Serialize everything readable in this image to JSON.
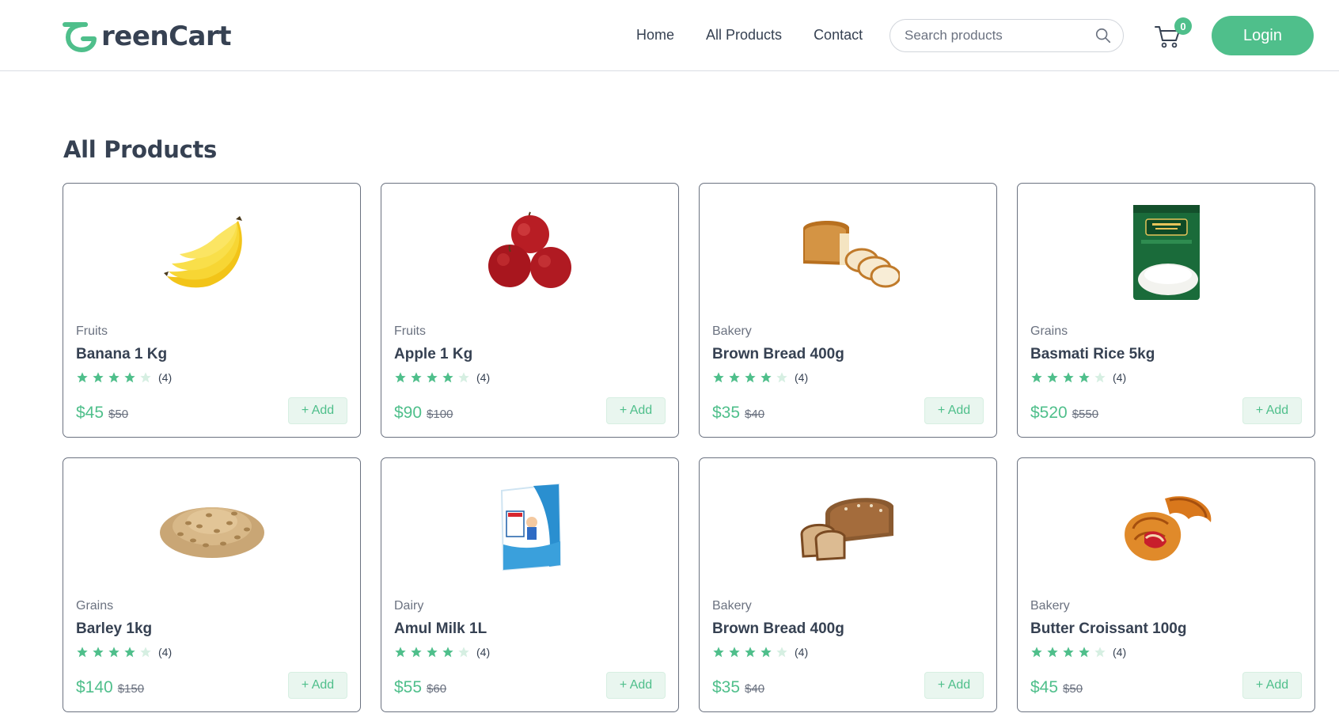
{
  "header": {
    "logo_text": "reenCart",
    "logo_initial": "G",
    "nav": [
      {
        "label": "Home"
      },
      {
        "label": "All Products"
      },
      {
        "label": "Contact"
      }
    ],
    "search_placeholder": "Search products",
    "cart_count": "0",
    "login_label": "Login"
  },
  "main": {
    "title": "All Products",
    "products": [
      {
        "category": "Fruits",
        "name": "Banana 1 Kg",
        "rating": 4,
        "rating_label": "(4)",
        "price": "$45",
        "old_price": "$50",
        "add_label": "+ Add",
        "image": "banana-image"
      },
      {
        "category": "Fruits",
        "name": "Apple 1 Kg",
        "rating": 4,
        "rating_label": "(4)",
        "price": "$90",
        "old_price": "$100",
        "add_label": "+ Add",
        "image": "apple-image"
      },
      {
        "category": "Bakery",
        "name": "Brown Bread 400g",
        "rating": 4,
        "rating_label": "(4)",
        "price": "$35",
        "old_price": "$40",
        "add_label": "+ Add",
        "image": "sliced-bread-image"
      },
      {
        "category": "Grains",
        "name": "Basmati Rice 5kg",
        "rating": 4,
        "rating_label": "(4)",
        "price": "$520",
        "old_price": "$550",
        "add_label": "+ Add",
        "image": "rice-bag-image"
      },
      {
        "category": "Grains",
        "name": "Barley 1kg",
        "rating": 4,
        "rating_label": "(4)",
        "price": "$140",
        "old_price": "$150",
        "add_label": "+ Add",
        "image": "barley-image"
      },
      {
        "category": "Dairy",
        "name": "Amul Milk 1L",
        "rating": 4,
        "rating_label": "(4)",
        "price": "$55",
        "old_price": "$60",
        "add_label": "+ Add",
        "image": "milk-pouch-image"
      },
      {
        "category": "Bakery",
        "name": "Brown Bread 400g",
        "rating": 4,
        "rating_label": "(4)",
        "price": "$35",
        "old_price": "$40",
        "add_label": "+ Add",
        "image": "brown-loaf-image"
      },
      {
        "category": "Bakery",
        "name": "Butter Croissant 100g",
        "rating": 4,
        "rating_label": "(4)",
        "price": "$45",
        "old_price": "$50",
        "add_label": "+ Add",
        "image": "croissant-image"
      }
    ]
  },
  "colors": {
    "accent": "#4fbf8b",
    "accent_light": "#e9f6ef",
    "text_dark": "#364152",
    "text_muted": "#6b7280",
    "star_empty": "#d6efe2"
  }
}
